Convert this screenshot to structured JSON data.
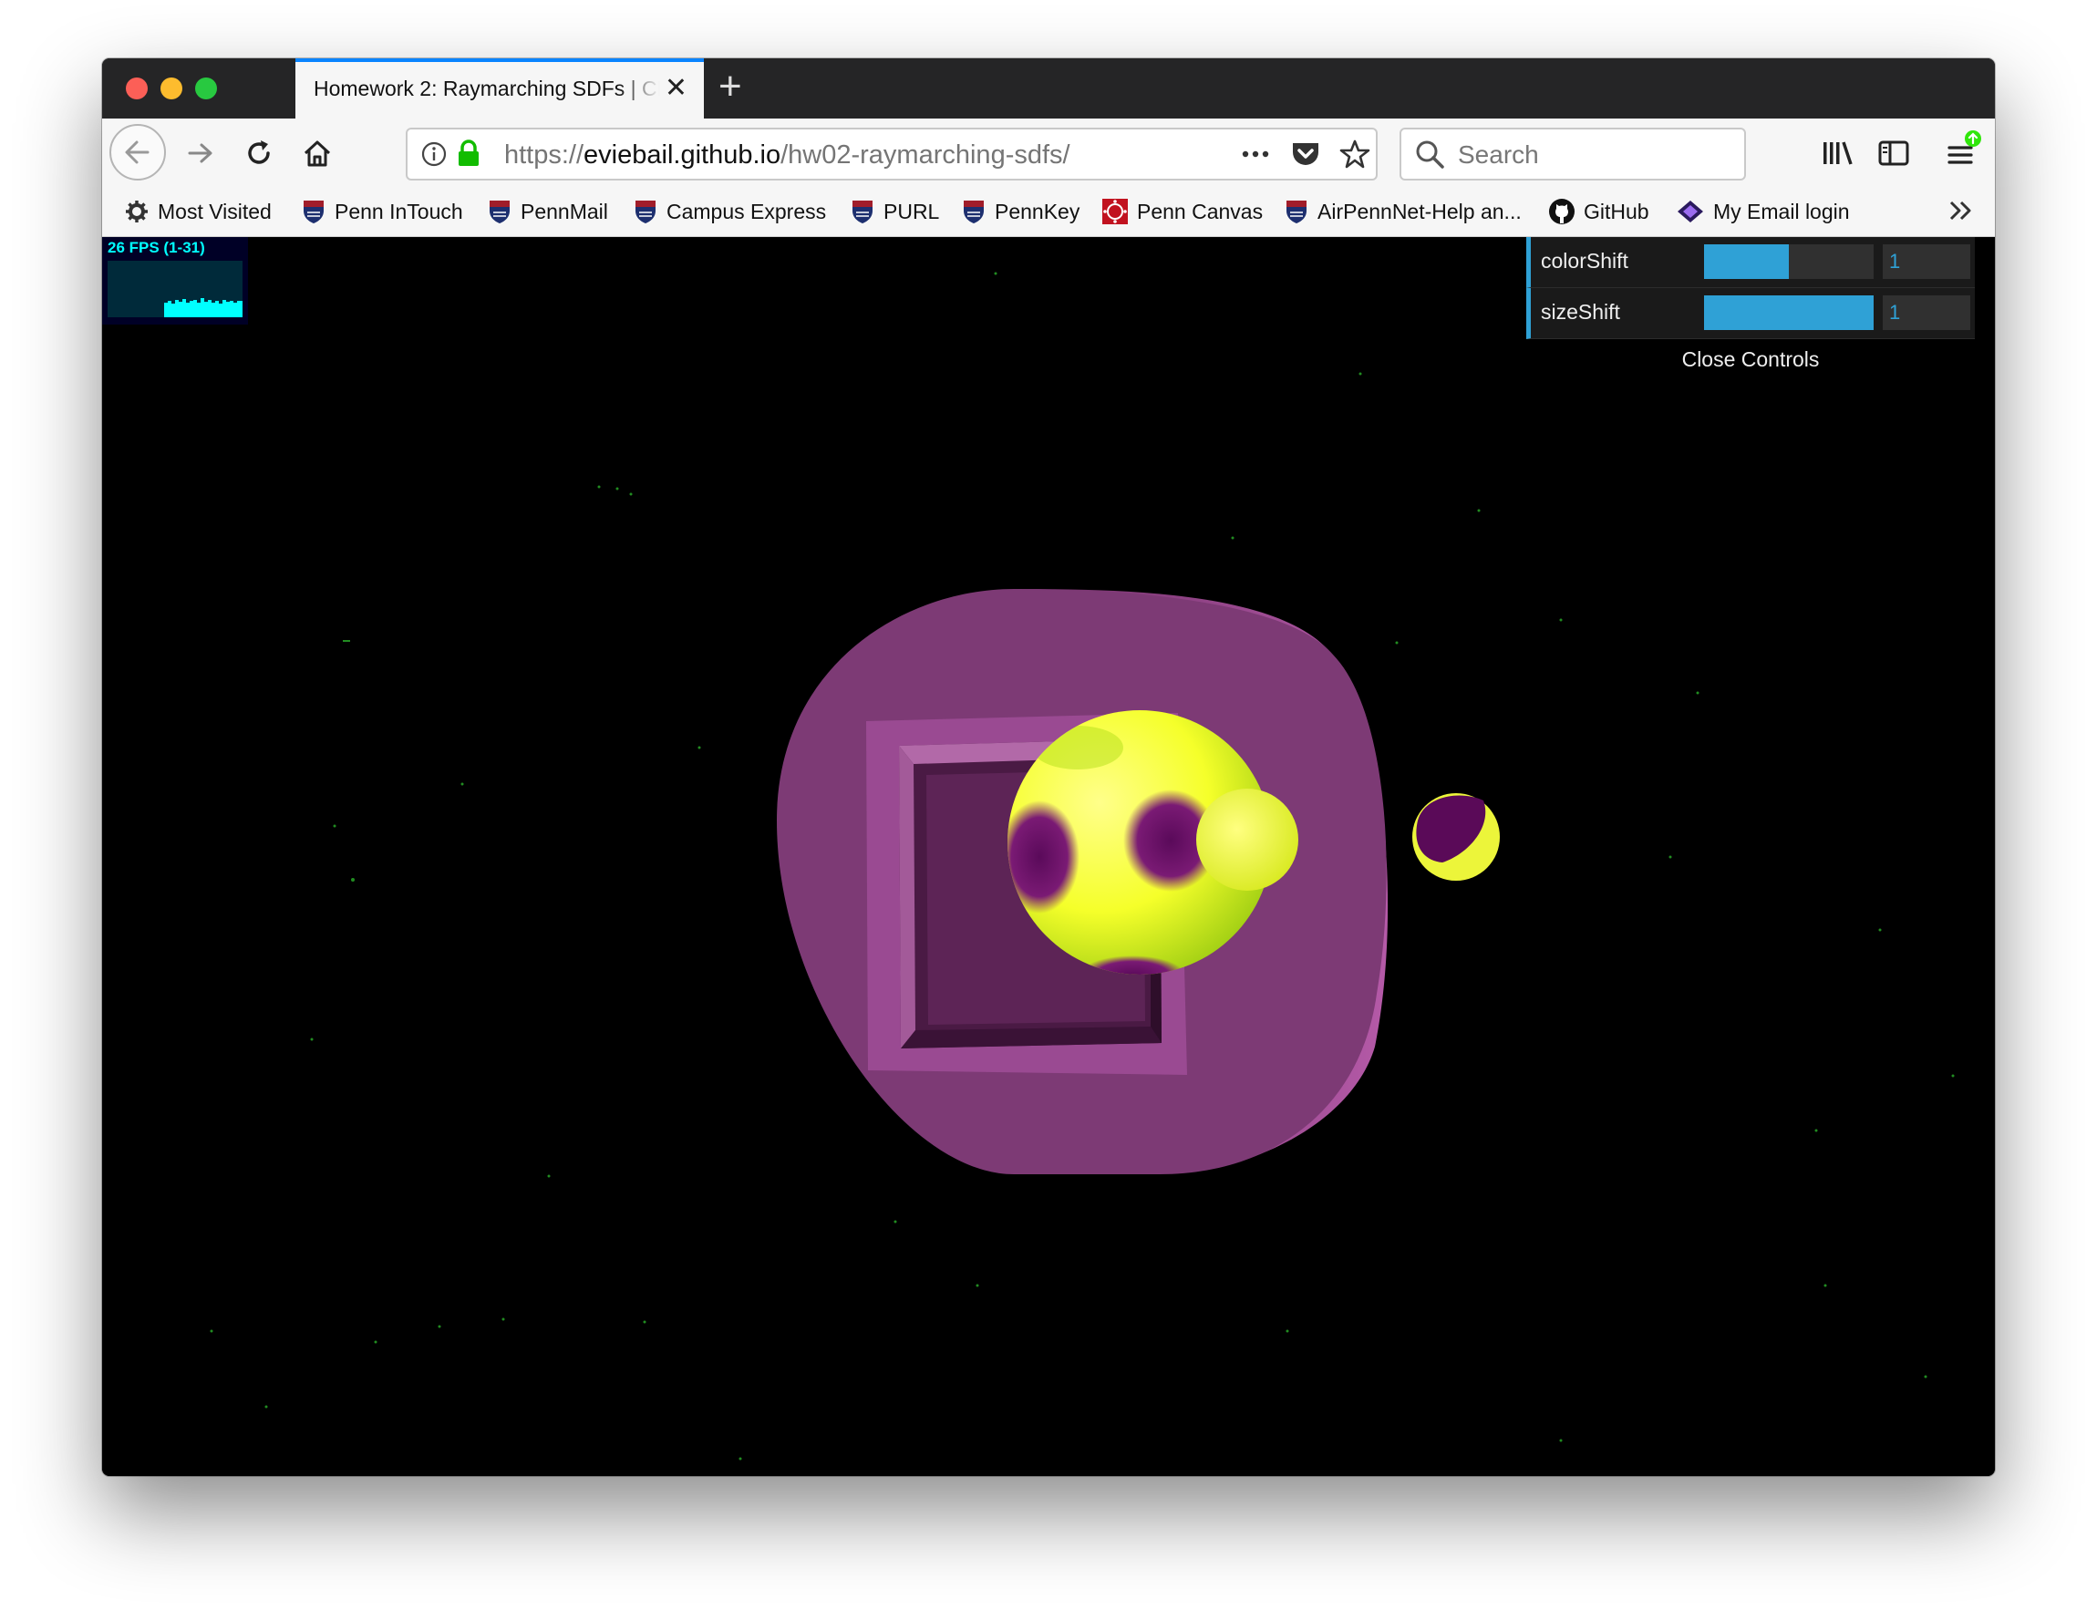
{
  "browser": {
    "tab_title": "Homework 2: Raymarching SDFs | CIS 566",
    "url_prefix": "https://",
    "url_host": "eviebail.github.io",
    "url_path": "/hw02-raymarching-sdfs/",
    "search_placeholder": "Search",
    "icons": {
      "back": "back-arrow-icon",
      "forward": "forward-arrow-icon",
      "reload": "reload-icon",
      "home": "home-icon",
      "info": "info-icon",
      "lock": "lock-icon",
      "more": "more-icon",
      "pocket": "pocket-icon",
      "bookmark": "star-icon",
      "search": "search-icon",
      "library": "library-icon",
      "sidebar": "sidebar-icon",
      "menu": "hamburger-menu-icon"
    }
  },
  "bookmarks": [
    {
      "label": "Most Visited",
      "icon": "gear-icon"
    },
    {
      "label": "Penn InTouch",
      "icon": "penn-shield-icon"
    },
    {
      "label": "PennMail",
      "icon": "penn-shield-icon"
    },
    {
      "label": "Campus Express",
      "icon": "penn-shield-icon"
    },
    {
      "label": "PURL",
      "icon": "penn-shield-icon"
    },
    {
      "label": "PennKey",
      "icon": "penn-shield-icon"
    },
    {
      "label": "Penn Canvas",
      "icon": "canvas-icon"
    },
    {
      "label": "AirPennNet-Help an...",
      "icon": "penn-shield-icon"
    },
    {
      "label": "GitHub",
      "icon": "github-icon"
    },
    {
      "label": "My Email login",
      "icon": "diamond-icon"
    }
  ],
  "stats": {
    "fps_text": "26 FPS (1-31)"
  },
  "controls": {
    "color_shift": {
      "label": "colorShift",
      "value": "1",
      "fill_fraction": 0.5
    },
    "size_shift": {
      "label": "sizeShift",
      "value": "1",
      "fill_fraction": 1.0
    },
    "close_label": "Close Controls"
  },
  "colors": {
    "accent": "#2fa1d6",
    "torus": "#8a3f80",
    "sphere": "#ffff3c",
    "sphere_spot": "#6a0a66",
    "stars": "#3cff3c"
  }
}
